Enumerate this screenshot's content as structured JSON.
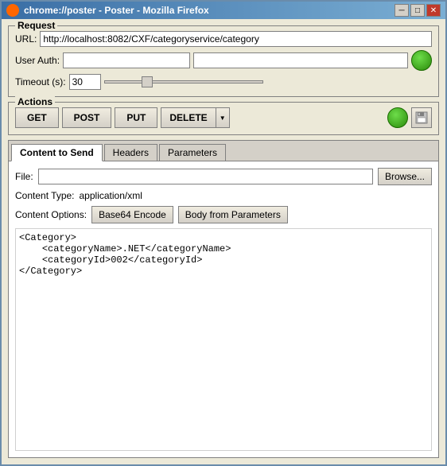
{
  "window": {
    "title": "chrome://poster - Poster - Mozilla Firefox",
    "min_label": "─",
    "max_label": "□",
    "close_label": "✕"
  },
  "request_section": {
    "title": "Request",
    "url_label": "URL:",
    "url_value": "http://localhost:8082/CXF/categoryservice/category",
    "user_auth_label": "User Auth:",
    "user_auth_placeholder1": "",
    "user_auth_placeholder2": "",
    "timeout_label": "Timeout (s):",
    "timeout_value": "30"
  },
  "actions_section": {
    "title": "Actions",
    "get_label": "GET",
    "post_label": "POST",
    "put_label": "PUT",
    "delete_label": "DELETE",
    "floppy_icon": "💾"
  },
  "tabs": {
    "content_to_send_label": "Content to Send",
    "headers_label": "Headers",
    "parameters_label": "Parameters"
  },
  "content_tab": {
    "file_label": "File:",
    "browse_label": "Browse...",
    "content_type_label": "Content Type:",
    "content_type_value": "application/xml",
    "content_options_label": "Content Options:",
    "base64_label": "Base64 Encode",
    "body_params_label": "Body from Parameters",
    "body_text": "<Category>\n    <categoryName>.NET</categoryName>\n    <categoryId>002</categoryId>\n</Category>"
  }
}
